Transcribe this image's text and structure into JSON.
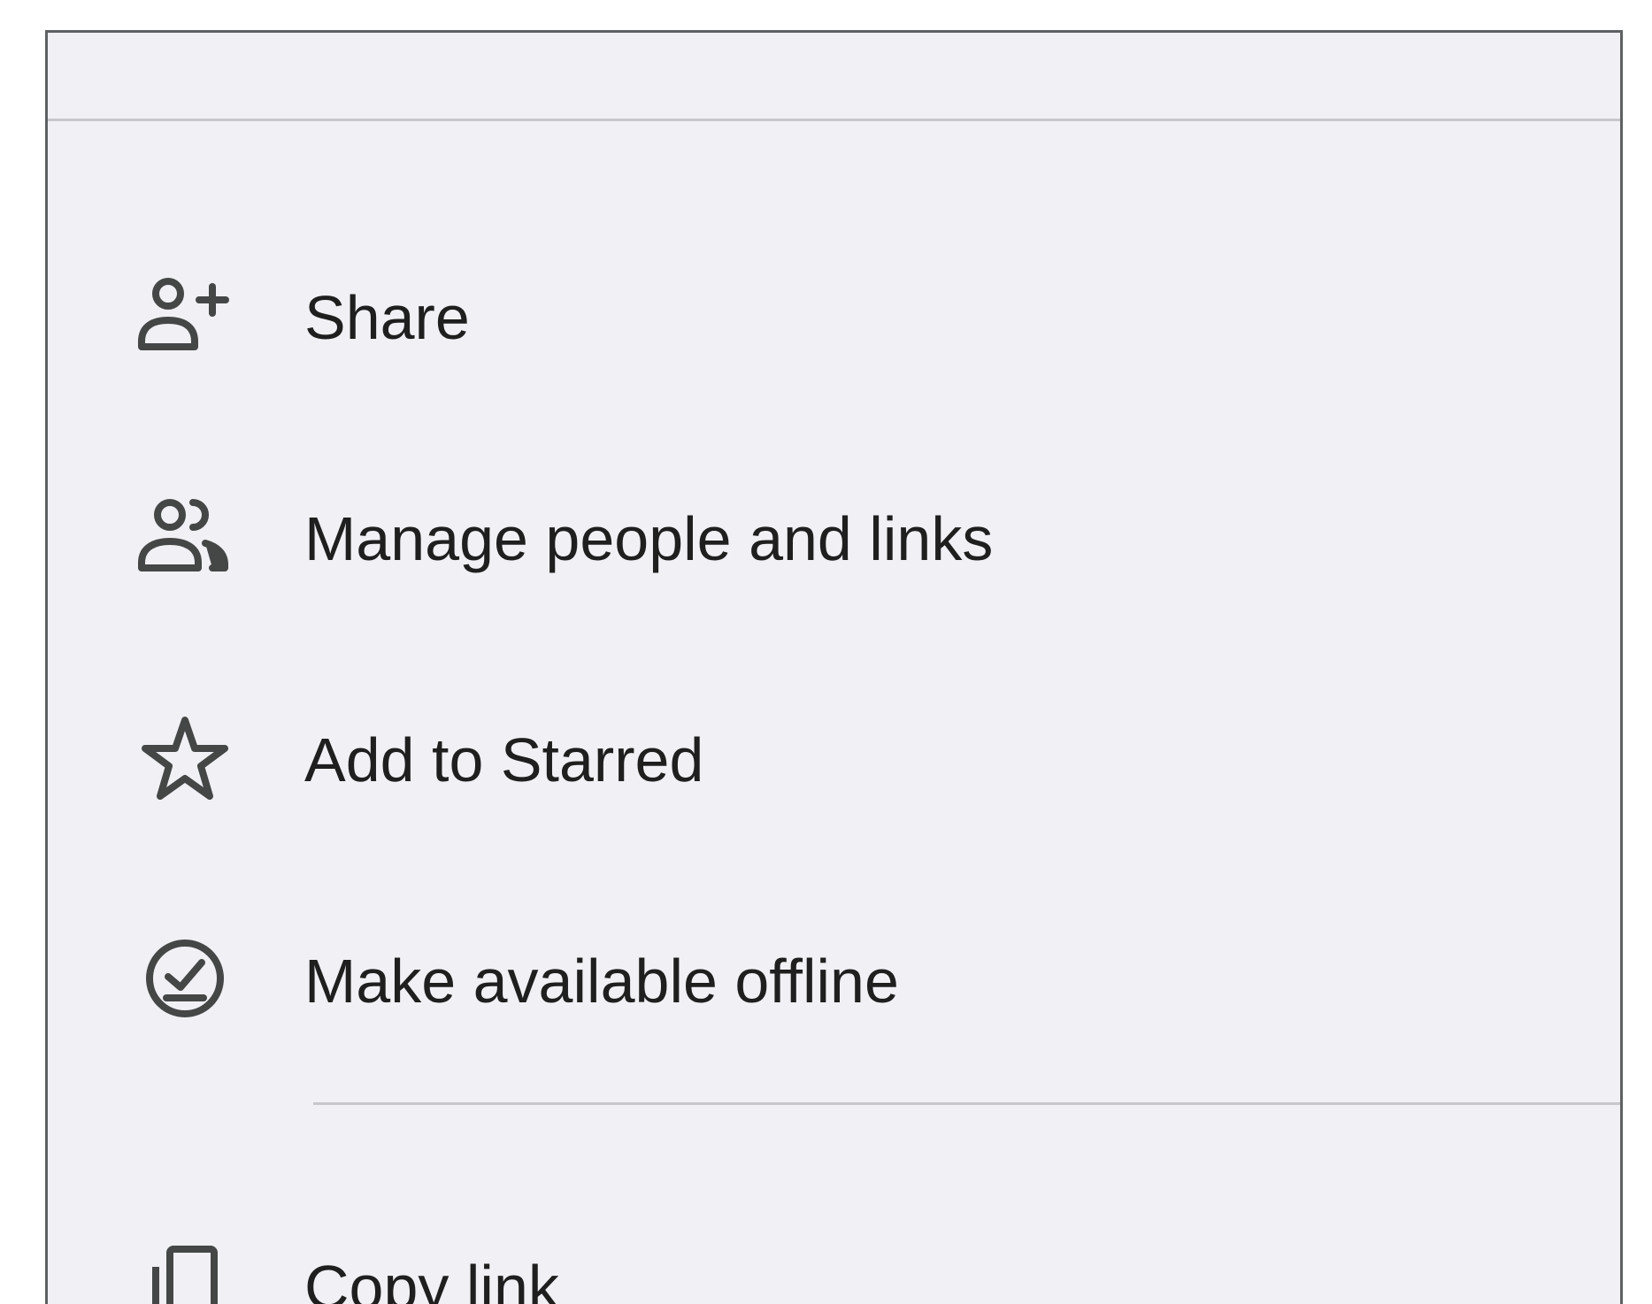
{
  "menu": {
    "items": [
      {
        "label": "Share",
        "icon": "person-add-icon"
      },
      {
        "label": "Manage people and links",
        "icon": "people-icon"
      },
      {
        "label": "Add to Starred",
        "icon": "star-outline-icon"
      },
      {
        "label": "Make available offline",
        "icon": "offline-check-icon"
      },
      {
        "label": "Copy link",
        "icon": "copy-link-icon"
      }
    ]
  },
  "colors": {
    "menu_background": "#f1f0f5",
    "text": "#1f1f1f",
    "icon": "#444746",
    "divider": "#c8c8cc",
    "border": "#5f6062"
  }
}
